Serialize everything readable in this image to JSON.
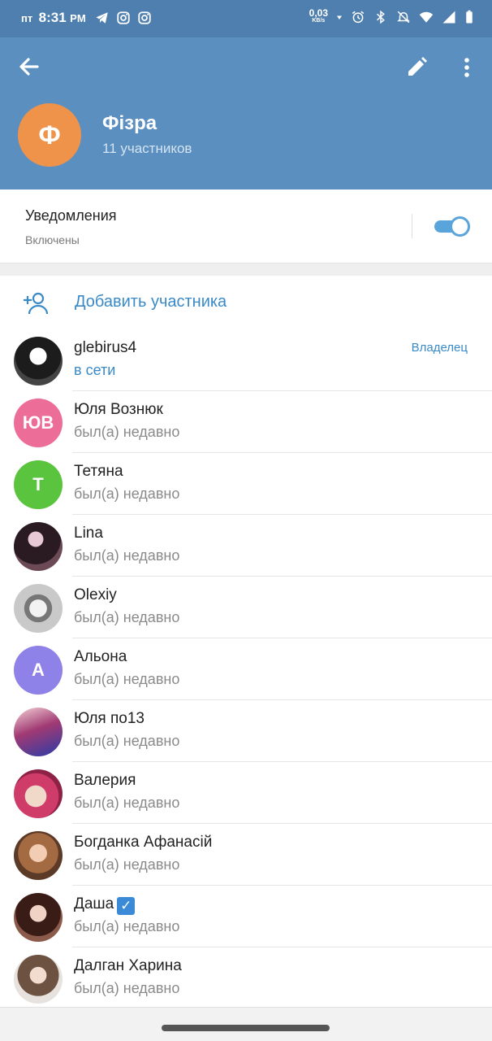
{
  "status_bar": {
    "day": "пт",
    "time": "8:31",
    "ampm": "PM",
    "net_speed_value": "0,03",
    "net_speed_unit": "KB/s",
    "icons": [
      "telegram-icon",
      "instagram-icon",
      "instagram-icon",
      "data-arrow-icon",
      "alarm-icon",
      "bluetooth-icon",
      "mute-icon",
      "wifi-icon",
      "signal-icon",
      "battery-icon"
    ]
  },
  "header": {
    "avatar_letter": "Ф",
    "avatar_color": "#f0934a",
    "title": "Фізра",
    "subtitle": "11 участников",
    "background": "#5b8fc0",
    "icons": [
      "back-arrow-icon",
      "pencil-icon",
      "more-vertical-icon"
    ]
  },
  "notifications": {
    "title": "Уведомления",
    "subtitle": "Включены",
    "enabled": true
  },
  "members": {
    "add_label": "Добавить участника",
    "accent_color": "#3a8ac8",
    "list": [
      {
        "name": "glebirus4",
        "status": "в сети",
        "online": true,
        "role": "Владелец"
      },
      {
        "name": "Юля Вознюк",
        "status": "был(а) недавно",
        "initials": "ЮВ",
        "avatar_color": "#ec6d97"
      },
      {
        "name": "Тетяна",
        "status": "был(а) недавно",
        "initials": "Т",
        "avatar_color": "#5bc43f"
      },
      {
        "name": "Lina",
        "status": "был(а) недавно"
      },
      {
        "name": "Olexiy",
        "status": "был(а) недавно"
      },
      {
        "name": "Альона",
        "status": "был(а) недавно",
        "initials": "А",
        "avatar_color": "#8e81e8"
      },
      {
        "name": "Юля по13",
        "status": "был(а) недавно"
      },
      {
        "name": "Валерия",
        "status": "был(а) недавно"
      },
      {
        "name": "Богданка Афанасій",
        "status": "был(а) недавно"
      },
      {
        "name": "Даша",
        "status": "был(а) недавно",
        "badge": "✓"
      },
      {
        "name": "Далган Харина",
        "status": "был(а) недавно"
      }
    ]
  }
}
